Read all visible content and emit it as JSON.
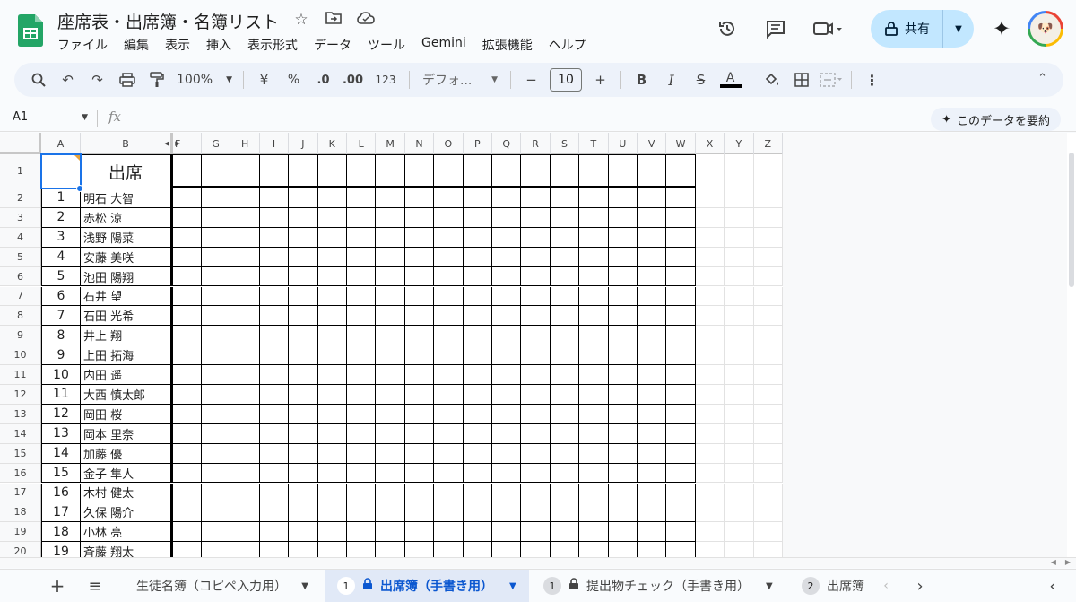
{
  "app": {
    "title": "座席表・出席簿・名簿リスト",
    "menu": [
      "ファイル",
      "編集",
      "表示",
      "挿入",
      "表示形式",
      "データ",
      "ツール",
      "Gemini",
      "拡張機能",
      "ヘルプ"
    ],
    "share_label": "共有",
    "icons": {
      "star": "star-icon",
      "move": "move-to-folder-icon",
      "cloud": "cloud-status-icon",
      "history": "history-icon",
      "comments": "comments-icon",
      "meet": "video-call-icon",
      "gemini": "gemini-spark-icon"
    }
  },
  "toolbar": {
    "zoom": "100%",
    "currency": "¥",
    "percent": "%",
    "dec_decrease": ".0",
    "dec_increase": ".00",
    "number_format": "123",
    "font": "デフォ...",
    "font_size": "10",
    "bold": "B",
    "italic": "I",
    "text_color": "A"
  },
  "formula_bar": {
    "cell_ref": "A1",
    "fx": "fx",
    "summarize_label": "このデータを要約"
  },
  "grid": {
    "columns": [
      "A",
      "B",
      "F",
      "G",
      "H",
      "I",
      "J",
      "K",
      "L",
      "M",
      "N",
      "O",
      "P",
      "Q",
      "R",
      "S",
      "T",
      "U",
      "V",
      "W",
      "X",
      "Y",
      "Z"
    ],
    "header_title": "出席",
    "row_numbers": [
      "1",
      "2",
      "3",
      "4",
      "5",
      "6",
      "7",
      "8",
      "9",
      "10",
      "11",
      "12",
      "13",
      "14",
      "15",
      "16",
      "17",
      "18",
      "19",
      "20"
    ],
    "students": [
      {
        "no": "1",
        "name": "明石 大智"
      },
      {
        "no": "2",
        "name": "赤松 涼"
      },
      {
        "no": "3",
        "name": "浅野 陽菜"
      },
      {
        "no": "4",
        "name": "安藤 美咲"
      },
      {
        "no": "5",
        "name": "池田 陽翔"
      },
      {
        "no": "6",
        "name": "石井 望"
      },
      {
        "no": "7",
        "name": "石田 光希"
      },
      {
        "no": "8",
        "name": "井上 翔"
      },
      {
        "no": "9",
        "name": "上田 拓海"
      },
      {
        "no": "10",
        "name": "内田 遥"
      },
      {
        "no": "11",
        "name": "大西 慎太郎"
      },
      {
        "no": "12",
        "name": "岡田 桜"
      },
      {
        "no": "13",
        "name": "岡本 里奈"
      },
      {
        "no": "14",
        "name": "加藤 優"
      },
      {
        "no": "15",
        "name": "金子 隼人"
      },
      {
        "no": "16",
        "name": "木村 健太"
      },
      {
        "no": "17",
        "name": "久保 陽介"
      },
      {
        "no": "18",
        "name": "小林 亮"
      },
      {
        "no": "19",
        "name": "斉藤 翔太"
      }
    ]
  },
  "sheets": {
    "add": "+",
    "list": "≡",
    "tabs": [
      {
        "label": "生徒名簿（コピペ入力用）",
        "badge": "",
        "locked": false,
        "active": false
      },
      {
        "label": "出席簿（手書き用）",
        "badge": "1",
        "locked": true,
        "active": true
      },
      {
        "label": "提出物チェック（手書き用）",
        "badge": "1",
        "locked": true,
        "active": false
      },
      {
        "label": "出席簿",
        "badge": "2",
        "locked": false,
        "active": false
      }
    ]
  }
}
